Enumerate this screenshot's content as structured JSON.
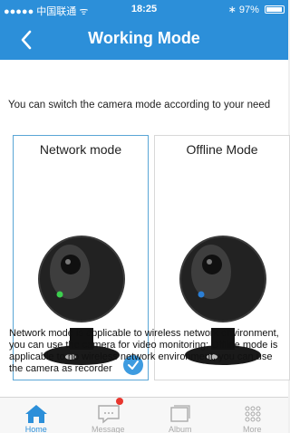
{
  "status_bar": {
    "carrier": "●●●●● 中国联通 ᯤ",
    "time": "18:25",
    "battery": "97%",
    "battery_level": 0.97
  },
  "nav": {
    "title": "Working Mode",
    "back_icon": "chevron-left-icon"
  },
  "intro": "You can switch the camera mode according to your need",
  "modes": [
    {
      "label": "Network mode",
      "selected": true,
      "led_color": "#3ccf4e"
    },
    {
      "label": "Offline Mode",
      "selected": false,
      "led_color": "#2b7fd6"
    }
  ],
  "description": "Network mode is applicable to wireless network environment, you can use the camera for video monitoring; Offline mode is applicable to no wireless network environment, you can use the camera as recorder",
  "tabs": [
    {
      "label": "Home",
      "icon": "home-icon",
      "active": true
    },
    {
      "label": "Message",
      "icon": "message-icon",
      "active": false,
      "badge": true
    },
    {
      "label": "Album",
      "icon": "album-icon",
      "active": false
    },
    {
      "label": "More",
      "icon": "more-grid-icon",
      "active": false
    }
  ],
  "colors": {
    "accent": "#2c8fd9",
    "badge": "#e8362e",
    "check": "#3d9be0"
  }
}
